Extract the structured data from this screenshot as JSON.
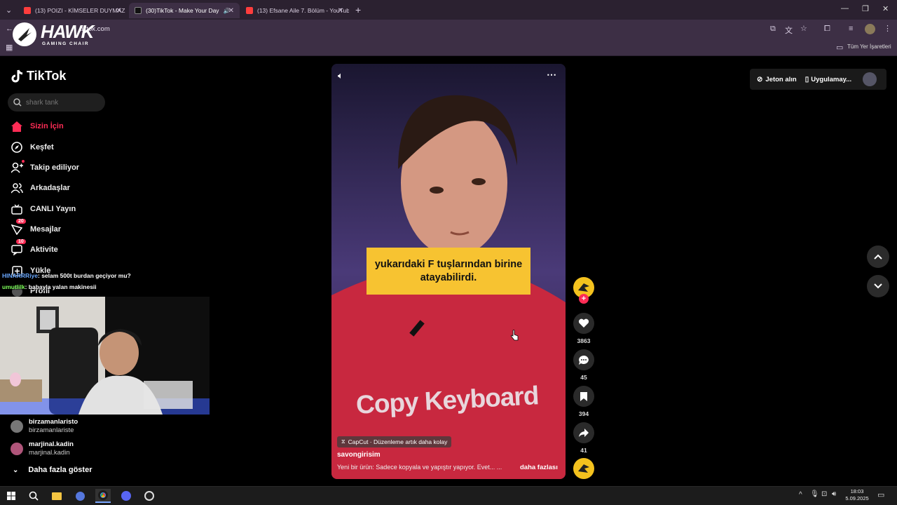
{
  "browser": {
    "tabs": [
      {
        "title": "(13) POIZI - KİMSELER DUYMAZ",
        "active": false
      },
      {
        "title": "(30)TikTok - Make Your Day",
        "active": true
      },
      {
        "title": "(13) Efsane Aile 7. Bölüm - YouTube",
        "active": false
      }
    ],
    "url": "tiktok.com",
    "bookmarks_label": "Tüm Yer İşaretleri"
  },
  "overlay_logo": {
    "word": "HAWK",
    "sub": "GAMING CHAIR"
  },
  "sidebar": {
    "logo": "TikTok",
    "search_placeholder": "shark tank",
    "items": [
      {
        "label": "Sizin İçin",
        "icon": "home-icon",
        "active": true
      },
      {
        "label": "Keşfet",
        "icon": "compass-icon"
      },
      {
        "label": "Takip ediliyor",
        "icon": "following-icon"
      },
      {
        "label": "Arkadaşlar",
        "icon": "friends-icon"
      },
      {
        "label": "CANLI Yayın",
        "icon": "live-icon"
      },
      {
        "label": "Mesajlar",
        "icon": "messages-icon",
        "badge": "20"
      },
      {
        "label": "Aktivite",
        "icon": "activity-icon",
        "badge": "10"
      },
      {
        "label": "Yükle",
        "icon": "upload-icon"
      },
      {
        "label": "Profil",
        "icon": "profile-icon"
      }
    ],
    "following": [
      {
        "name": "birzamanlaristo",
        "user": "birzamanlariste"
      },
      {
        "name": "marjinal.kadin",
        "user": "marjinal.kadin"
      }
    ],
    "show_more": "Daha fazla göster"
  },
  "stream_chat": [
    {
      "user": "HINARRRiye",
      "message": ": selam 500t burdan geçiyor mu?",
      "color": "#6aa8ff"
    },
    {
      "user": "umutlilk",
      "message": ": babayla yalan makinesii",
      "color": "#7dff5a"
    }
  ],
  "video": {
    "caption_line1": "yukarıdaki F tuşlarından birine",
    "caption_line2": "atayabilirdi.",
    "shirt_text": "Copy Keyboard",
    "capcut_label": "CapCut · Düzenleme artık daha kolay",
    "author": "savongirisim",
    "description": "Yeni bir ürün: Sadece kopyala ve yapıştır yapıyor. Evet... ...",
    "more_label": "daha fazlası"
  },
  "actions": {
    "likes": "3863",
    "comments": "45",
    "saves": "394",
    "shares": "41"
  },
  "top_right": {
    "coins": "Jeton alın",
    "app": "Uygulamay..."
  },
  "taskbar": {
    "time": "18:03",
    "date": "5.09.2025"
  },
  "colors": {
    "accent": "#fe2c55",
    "caption_bg": "#f7c331"
  }
}
